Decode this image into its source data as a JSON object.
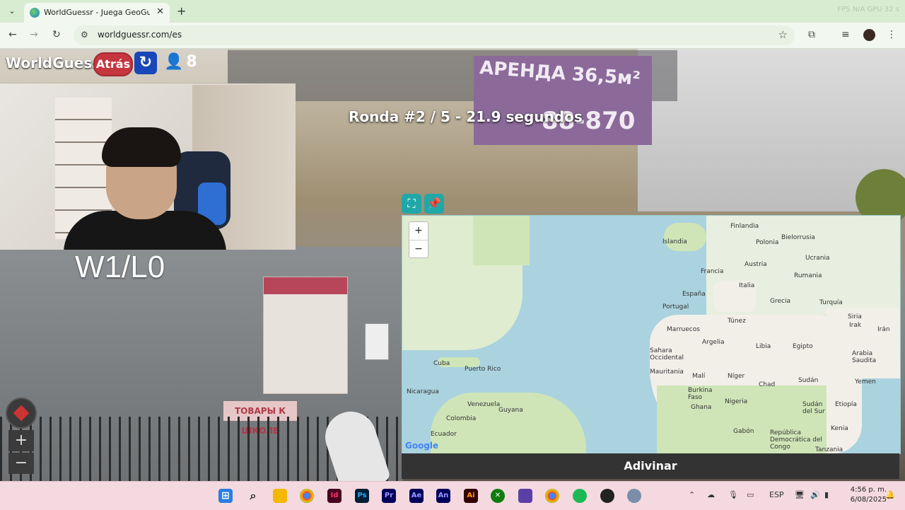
{
  "browser": {
    "tab_title": "WorldGuessr - Juega GeoGuessr",
    "url": "worldguessr.com/es",
    "window_info": "FPS N/A   GPU 32 s"
  },
  "hud": {
    "logo": "WorldGuessr",
    "back_label": "Atrás",
    "players_count": "8",
    "round_text": "Ronda #2 / 5 - 21.9 segundos"
  },
  "overlay": {
    "score_text": "W1/L0"
  },
  "street": {
    "sign_line1": "АРЕНДА 36,5м²",
    "sign_line2": "88-870",
    "shop_sign": "ТОВАРЫ К ШКОЛЕ"
  },
  "minimap": {
    "zoom_in": "+",
    "zoom_out": "−",
    "attribution": "Google",
    "labels": [
      "Islandia",
      "Finlandia",
      "Bielorrusia",
      "Polonia",
      "Ucrania",
      "Francia",
      "Austria",
      "Rumania",
      "Italia",
      "España",
      "Portugal",
      "Grecia",
      "Turquía",
      "Siria",
      "Irak",
      "Irán",
      "Túnez",
      "Marruecos",
      "Argelia",
      "Libia",
      "Egipto",
      "Sahara Occidental",
      "Arabia Saudita",
      "Mauritania",
      "Malí",
      "Níger",
      "Chad",
      "Sudán",
      "Yemen",
      "Burkina Faso",
      "Ghana",
      "Nigeria",
      "Sudán del Sur",
      "Etiopía",
      "Kenia",
      "Gabón",
      "República Democrática del Congo",
      "Tanzania",
      "Cuba",
      "Puerto Rico",
      "Nicaragua",
      "Venezuela",
      "Guyana",
      "Colombia",
      "Ecuador"
    ],
    "guess_label": "Adivinar"
  },
  "taskbar": {
    "lang": "ESP",
    "time": "4:56 p. m.",
    "date": "6/08/2025"
  }
}
